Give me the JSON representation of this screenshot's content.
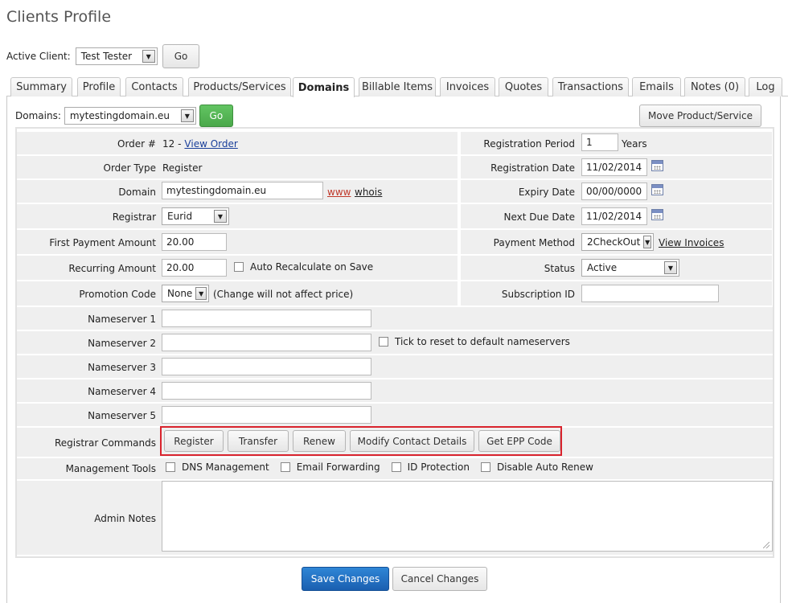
{
  "page": {
    "title": "Clients Profile"
  },
  "active_client": {
    "label": "Active Client:",
    "value": "Test Tester",
    "go": "Go"
  },
  "tabs": [
    {
      "label": "Summary"
    },
    {
      "label": "Profile"
    },
    {
      "label": "Contacts"
    },
    {
      "label": "Products/Services"
    },
    {
      "label": "Domains",
      "active": true
    },
    {
      "label": "Billable Items"
    },
    {
      "label": "Invoices"
    },
    {
      "label": "Quotes"
    },
    {
      "label": "Transactions"
    },
    {
      "label": "Emails"
    },
    {
      "label": "Notes (0)"
    },
    {
      "label": "Log"
    }
  ],
  "domains_select": {
    "label": "Domains:",
    "value": "mytestingdomain.eu",
    "go": "Go"
  },
  "move_button": "Move Product/Service",
  "form": {
    "order": {
      "label": "Order #",
      "number": "12 -",
      "link": "View Order"
    },
    "order_type": {
      "label": "Order Type",
      "value": "Register"
    },
    "domain": {
      "label": "Domain",
      "value": "mytestingdomain.eu",
      "www": "www",
      "whois": "whois"
    },
    "registrar": {
      "label": "Registrar",
      "value": "Eurid"
    },
    "first_payment": {
      "label": "First Payment Amount",
      "value": "20.00"
    },
    "recurring": {
      "label": "Recurring Amount",
      "value": "20.00",
      "auto_recalc": "Auto Recalculate on Save"
    },
    "promotion": {
      "label": "Promotion Code",
      "value": "None",
      "note": "(Change will not affect price)"
    },
    "reg_period": {
      "label": "Registration Period",
      "value": "1",
      "unit": "Years"
    },
    "reg_date": {
      "label": "Registration Date",
      "value": "11/02/2014"
    },
    "expiry_date": {
      "label": "Expiry Date",
      "value": "00/00/0000"
    },
    "next_due": {
      "label": "Next Due Date",
      "value": "11/02/2014"
    },
    "payment_method": {
      "label": "Payment Method",
      "value": "2CheckOut",
      "link": "View Invoices"
    },
    "status": {
      "label": "Status",
      "value": "Active"
    },
    "subscription": {
      "label": "Subscription ID",
      "value": ""
    },
    "nameservers": [
      {
        "label": "Nameserver 1",
        "value": ""
      },
      {
        "label": "Nameserver 2",
        "value": ""
      },
      {
        "label": "Nameserver 3",
        "value": ""
      },
      {
        "label": "Nameserver 4",
        "value": ""
      },
      {
        "label": "Nameserver 5",
        "value": ""
      }
    ],
    "ns_reset": "Tick to reset to default nameservers",
    "registrar_commands": {
      "label": "Registrar Commands",
      "buttons": [
        "Register",
        "Transfer",
        "Renew",
        "Modify Contact Details",
        "Get EPP Code"
      ]
    },
    "management_tools": {
      "label": "Management Tools",
      "items": [
        "DNS Management",
        "Email Forwarding",
        "ID Protection",
        "Disable Auto Renew"
      ]
    },
    "admin_notes": {
      "label": "Admin Notes",
      "value": ""
    }
  },
  "actions": {
    "save": "Save Changes",
    "cancel": "Cancel Changes"
  },
  "colors": {
    "highlight_border": "#d9232d",
    "go_green": "#4aa84a",
    "save_blue": "#1a5fb0",
    "link": "#1a3f9a",
    "www_red": "#c0392b"
  }
}
